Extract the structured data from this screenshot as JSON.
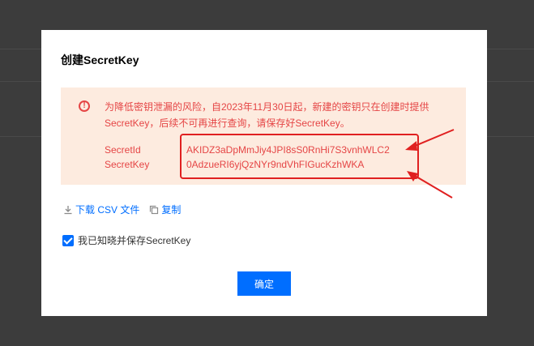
{
  "dialog": {
    "title": "创建SecretKey",
    "notice": {
      "text": "为降低密钥泄漏的风险，自2023年11月30日起，新建的密钥只在创建时提供SecretKey，后续不可再进行查询，请保存好SecretKey。",
      "secret_id_label": "SecretId",
      "secret_id_value": "AKIDZ3aDpMmJiy4JPI8sS0RnHi7S3vnhWLC2",
      "secret_key_label": "SecretKey",
      "secret_key_value": "0AdzueRI6yjQzNYr9ndVhFIGucKzhWKA"
    },
    "actions": {
      "download_label": "下载 CSV 文件",
      "copy_label": "复制"
    },
    "checkbox": {
      "label": "我已知晓并保存SecretKey",
      "checked": true
    },
    "confirm_label": "确定"
  },
  "colors": {
    "accent": "#006eff",
    "warning_text": "#e54545",
    "notice_bg": "#fdebdf",
    "annotation_red": "#e02020"
  },
  "icons": [
    "warning-icon",
    "download-icon",
    "copy-icon",
    "checkbox-check-icon",
    "arrow-annotation-icon"
  ]
}
